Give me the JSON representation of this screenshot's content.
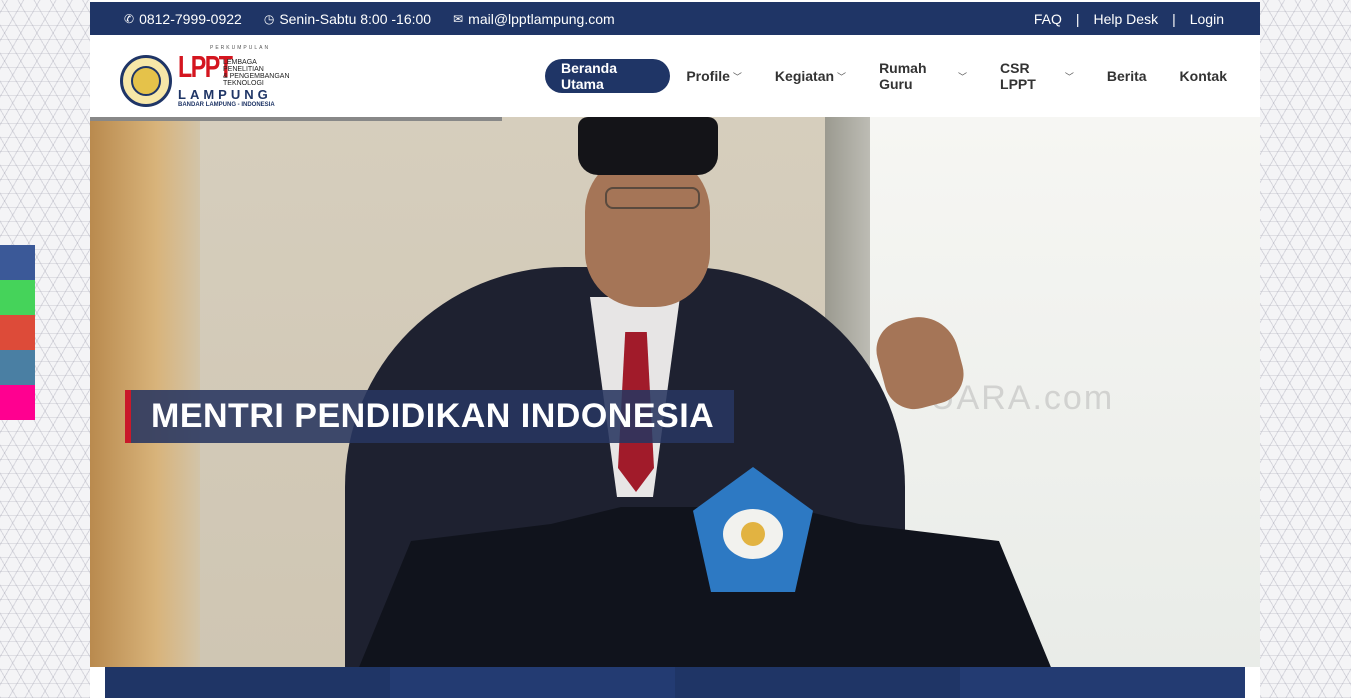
{
  "topbar": {
    "phone": "0812-7999-0922",
    "hours": "Senin-Sabtu 8:00 -16:00",
    "email": "mail@lpptlampung.com",
    "links": [
      "FAQ",
      "Help Desk",
      "Login"
    ]
  },
  "logo": {
    "perkumpulan": "PERKUMPULAN",
    "lppt": "LPPT",
    "line1": "LEMBAGA",
    "line2": "PENELITIAN",
    "line3": "& PENGEMBANGAN",
    "line4": "TEKNOLOGI",
    "lampung": "LAMPUNG",
    "bandar": "BANDAR LAMPUNG - INDONESIA"
  },
  "nav": {
    "active": "Beranda Utama",
    "profile": "Profile",
    "kegiatan": "Kegiatan",
    "rumah_guru": "Rumah Guru",
    "csr": "CSR LPPT",
    "berita": "Berita",
    "kontak": "Kontak"
  },
  "hero": {
    "caption": "MENTRI PENDIDIKAN INDONESIA",
    "watermark": "UARA.com"
  },
  "social": {
    "colors": [
      "#3b5998",
      "#45d35a",
      "#dd4b39",
      "#4a7fa3",
      "#ff0090"
    ],
    "icons": [
      "facebook-icon",
      "whatsapp-icon",
      "google-plus-icon",
      "twitter-icon",
      "instagram-icon"
    ]
  },
  "colors": {
    "primary": "#1f3566",
    "accent": "#c9192a"
  }
}
